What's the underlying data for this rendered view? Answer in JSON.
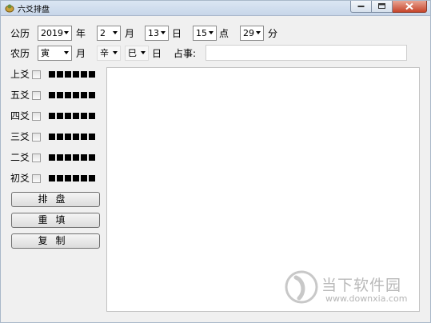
{
  "window": {
    "title": "六爻排盘"
  },
  "row1": {
    "gongli": "公历",
    "year": "2019",
    "year_unit": "年",
    "month": "2",
    "month_unit": "月",
    "day": "13",
    "day_unit": "日",
    "hour": "15",
    "hour_unit": "点",
    "minute": "29",
    "minute_unit": "分"
  },
  "row2": {
    "nongli": "农历",
    "lunar_month": "寅",
    "lunar_month_unit": "月",
    "day_stem": "辛",
    "day_branch": "巳",
    "day_unit": "日",
    "divination_label": "占事:",
    "divination_value": ""
  },
  "yao_rows": [
    {
      "label": "上爻"
    },
    {
      "label": "五爻"
    },
    {
      "label": "四爻"
    },
    {
      "label": "三爻"
    },
    {
      "label": "二爻"
    },
    {
      "label": "初爻"
    }
  ],
  "buttons": {
    "arrange": "排盘",
    "refill": "重填",
    "copy": "复制"
  },
  "output_text": "",
  "watermark": {
    "brand": "当下软件园",
    "url": "www.downxia.com"
  }
}
